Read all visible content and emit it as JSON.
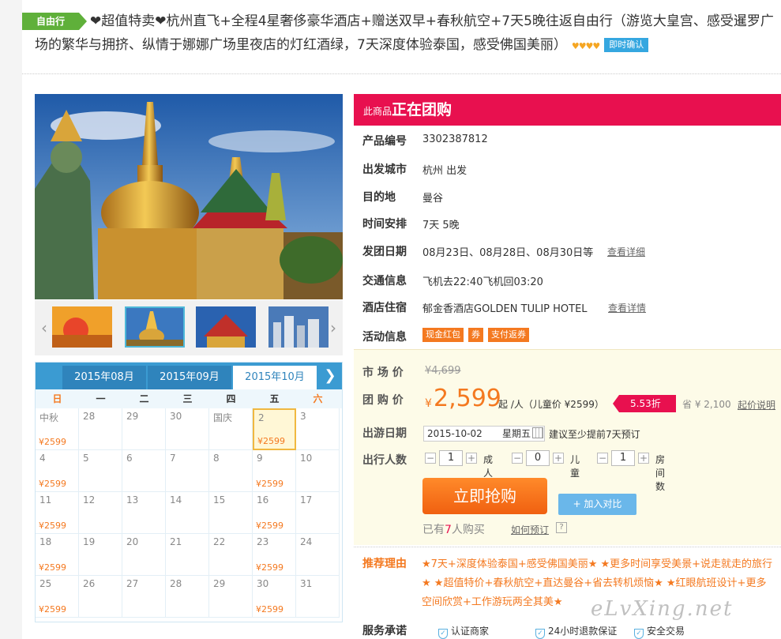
{
  "header": {
    "tag": "自由行",
    "title": "❤超值特卖❤杭州直飞+全程4星奢侈豪华酒店+赠送双早+春秋航空+7天5晚往返自由行（游览大皇宫、感受暹罗广场的繁华与拥挤、纵情于娜娜广场里夜店的灯红酒绿，7天深度体验泰国，感受佛国美丽）",
    "rating_hearts": "♥♥♥♥",
    "confirm_badge": "即时确认"
  },
  "calendar": {
    "tabs": [
      "2015年08月",
      "2015年09月",
      "2015年10月"
    ],
    "active_tab": 2,
    "next_icon": "chevron-right-icon",
    "weekdays": [
      "日",
      "一",
      "二",
      "三",
      "四",
      "五",
      "六"
    ],
    "cells": [
      {
        "d": "中秋",
        "p": "¥2599"
      },
      {
        "d": "28",
        "p": ""
      },
      {
        "d": "29",
        "p": ""
      },
      {
        "d": "30",
        "p": ""
      },
      {
        "d": "国庆",
        "p": ""
      },
      {
        "d": "2",
        "p": "¥2599",
        "sel": true
      },
      {
        "d": "3",
        "p": ""
      },
      {
        "d": "4",
        "p": "¥2599"
      },
      {
        "d": "5",
        "p": ""
      },
      {
        "d": "6",
        "p": ""
      },
      {
        "d": "7",
        "p": ""
      },
      {
        "d": "8",
        "p": ""
      },
      {
        "d": "9",
        "p": "¥2599"
      },
      {
        "d": "10",
        "p": ""
      },
      {
        "d": "11",
        "p": "¥2599"
      },
      {
        "d": "12",
        "p": ""
      },
      {
        "d": "13",
        "p": ""
      },
      {
        "d": "14",
        "p": ""
      },
      {
        "d": "15",
        "p": ""
      },
      {
        "d": "16",
        "p": "¥2599"
      },
      {
        "d": "17",
        "p": ""
      },
      {
        "d": "18",
        "p": "¥2599"
      },
      {
        "d": "19",
        "p": ""
      },
      {
        "d": "20",
        "p": ""
      },
      {
        "d": "21",
        "p": ""
      },
      {
        "d": "22",
        "p": ""
      },
      {
        "d": "23",
        "p": "¥2599"
      },
      {
        "d": "24",
        "p": ""
      },
      {
        "d": "25",
        "p": "¥2599"
      },
      {
        "d": "26",
        "p": ""
      },
      {
        "d": "27",
        "p": ""
      },
      {
        "d": "28",
        "p": ""
      },
      {
        "d": "29",
        "p": ""
      },
      {
        "d": "30",
        "p": "¥2599"
      },
      {
        "d": "31",
        "p": ""
      }
    ]
  },
  "group": {
    "small": "此商品",
    "big": "正在团购"
  },
  "info": {
    "product_no_label": "产品编号",
    "product_no": "3302387812",
    "depart_city_label": "出发城市",
    "depart_city": "杭州 出发",
    "dest_label": "目的地",
    "dest": "曼谷",
    "schedule_label": "时间安排",
    "schedule": "7天 5晚",
    "dates_label": "发团日期",
    "dates": "08月23日、08月28日、08月30日等",
    "dates_link": "查看详细",
    "transport_label": "交通信息",
    "transport": "飞机去22:40飞机回03:20",
    "hotel_label": "酒店住宿",
    "hotel": "郁金香酒店GOLDEN TULIP HOTEL",
    "hotel_link": "查看详情",
    "promo_label": "活动信息",
    "promos": [
      "现金红包",
      "券",
      "支付返券"
    ]
  },
  "price": {
    "market_label": "市 场 价",
    "market": "¥4,699",
    "group_label": "团 购 价",
    "yen": "¥",
    "group_price": "2,599",
    "per": "起 /人（儿童价 ¥2599）",
    "discount": "5.53折",
    "save": "省 ¥ 2,100",
    "save_link": "起价说明",
    "date_label": "出游日期",
    "date_value": "2015-10-02",
    "weekday": "星期五",
    "advice": "建议至少提前7天预订",
    "people_label": "出行人数",
    "adults": "1",
    "adult_label": "成人",
    "children": "0",
    "child_label": "儿童",
    "rooms": "1",
    "room_label": "房间数",
    "buy_label": "立即抢购",
    "compare_label": "+ 加入对比",
    "bought_pre": "已有",
    "bought_count": "7",
    "bought_post": "人购买",
    "howto_link": "如何预订",
    "qmark": "?"
  },
  "reason": {
    "label": "推荐理由",
    "text": "★7天+深度体验泰国+感受佛国美丽★ ★更多时间享受美景+说走就走的旅行★ ★超值特价+春秋航空+直达曼谷+省去转机烦恼★ ★红眼航班设计+更多空间欣赏+工作游玩两全其美★"
  },
  "service": {
    "label": "服务承诺",
    "items": [
      "认证商家",
      "24小时退款保证",
      "安全交易"
    ]
  },
  "watermark": "eLvXing.net",
  "colors": {
    "brand_pink": "#e8104f",
    "orange": "#f47920",
    "blue": "#3b9bd2",
    "green": "#5fb03a"
  }
}
